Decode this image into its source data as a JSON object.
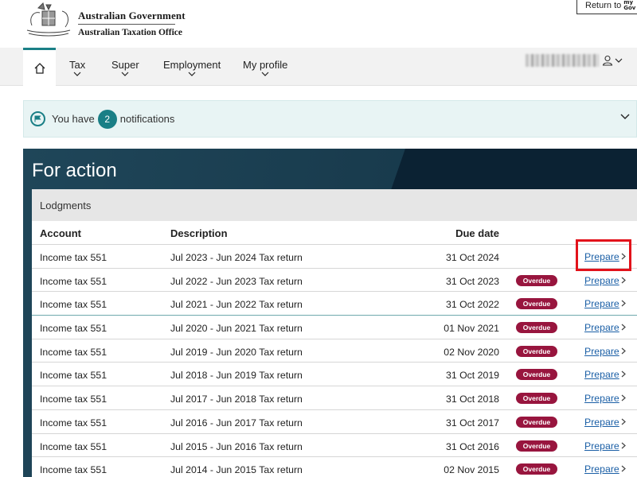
{
  "header": {
    "gov_line1": "Australian Government",
    "gov_line2": "Australian Taxation Office",
    "return_label": "Return to",
    "mygov_top": "my",
    "mygov_bottom": "Gov"
  },
  "nav": {
    "items": [
      {
        "label": "Tax"
      },
      {
        "label": "Super"
      },
      {
        "label": "Employment"
      },
      {
        "label": "My profile"
      }
    ]
  },
  "notifications": {
    "prefix": "You have",
    "count": "2",
    "suffix": "notifications"
  },
  "action": {
    "title": "For action",
    "section": "Lodgments",
    "columns": {
      "account": "Account",
      "description": "Description",
      "due": "Due date"
    },
    "prepare_label": "Prepare",
    "overdue_label": "Overdue",
    "rows": [
      {
        "account": "Income tax 551",
        "description": "Jul 2023 - Jun 2024 Tax return",
        "due": "31 Oct 2024",
        "overdue": false
      },
      {
        "account": "Income tax 551",
        "description": "Jul 2022 - Jun 2023 Tax return",
        "due": "31 Oct 2023",
        "overdue": true
      },
      {
        "account": "Income tax 551",
        "description": "Jul 2021 - Jun 2022 Tax return",
        "due": "31 Oct 2022",
        "overdue": true
      },
      {
        "account": "Income tax 551",
        "description": "Jul 2020 - Jun 2021 Tax return",
        "due": "01 Nov 2021",
        "overdue": true
      },
      {
        "account": "Income tax 551",
        "description": "Jul 2019 - Jun 2020 Tax return",
        "due": "02 Nov 2020",
        "overdue": true
      },
      {
        "account": "Income tax 551",
        "description": "Jul 2018 - Jun 2019 Tax return",
        "due": "31 Oct 2019",
        "overdue": true
      },
      {
        "account": "Income tax 551",
        "description": "Jul 2017 - Jun 2018 Tax return",
        "due": "31 Oct 2018",
        "overdue": true
      },
      {
        "account": "Income tax 551",
        "description": "Jul 2016 - Jun 2017 Tax return",
        "due": "31 Oct 2017",
        "overdue": true
      },
      {
        "account": "Income tax 551",
        "description": "Jul 2015 - Jun 2016 Tax return",
        "due": "31 Oct 2016",
        "overdue": true
      },
      {
        "account": "Income tax 551",
        "description": "Jul 2014 - Jun 2015 Tax return",
        "due": "02 Nov 2015",
        "overdue": true
      }
    ]
  },
  "colors": {
    "accent": "#1a7f86",
    "overdue": "#98153e",
    "link": "#1b5fa6",
    "highlight": "#e2121b"
  },
  "icons": [
    "coat-of-arms-icon",
    "home-icon",
    "chevron-down-icon",
    "user-icon",
    "flag-icon",
    "chevron-right-icon"
  ]
}
